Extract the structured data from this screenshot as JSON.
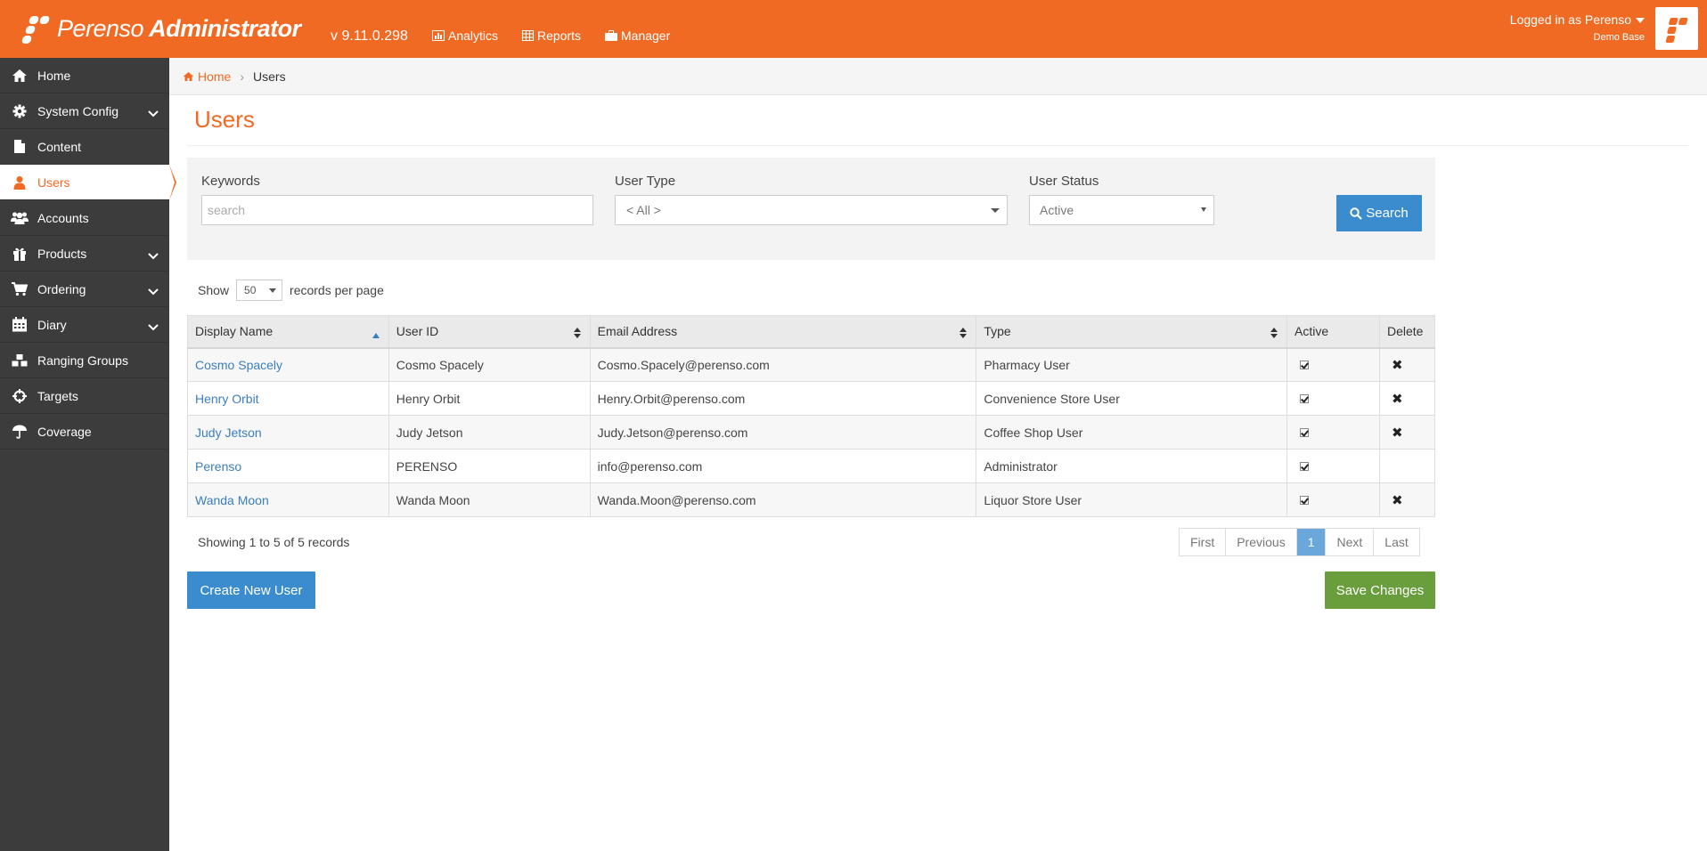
{
  "header": {
    "brand": "Perenso",
    "brand_suffix": "Administrator",
    "version": "v 9.11.0.298",
    "nav": [
      {
        "label": "Analytics",
        "icon": "bar-chart-icon"
      },
      {
        "label": "Reports",
        "icon": "table-icon"
      },
      {
        "label": "Manager",
        "icon": "briefcase-icon"
      }
    ],
    "account_label": "Logged in as Perenso",
    "account_base": "Demo Base"
  },
  "sidebar": {
    "items": [
      {
        "label": "Home",
        "icon": "home-icon",
        "expandable": false
      },
      {
        "label": "System Config",
        "icon": "gear-icon",
        "expandable": true
      },
      {
        "label": "Content",
        "icon": "file-icon",
        "expandable": false
      },
      {
        "label": "Users",
        "icon": "user-icon",
        "expandable": false,
        "active": true
      },
      {
        "label": "Accounts",
        "icon": "users-group-icon",
        "expandable": false
      },
      {
        "label": "Products",
        "icon": "gift-icon",
        "expandable": true
      },
      {
        "label": "Ordering",
        "icon": "cart-icon",
        "expandable": true
      },
      {
        "label": "Diary",
        "icon": "calendar-icon",
        "expandable": true
      },
      {
        "label": "Ranging Groups",
        "icon": "cubes-icon",
        "expandable": false
      },
      {
        "label": "Targets",
        "icon": "crosshairs-icon",
        "expandable": false
      },
      {
        "label": "Coverage",
        "icon": "umbrella-icon",
        "expandable": false
      }
    ]
  },
  "breadcrumb": {
    "home": "Home",
    "current": "Users"
  },
  "page": {
    "title": "Users"
  },
  "filters": {
    "keywords_label": "Keywords",
    "keywords_placeholder": "search",
    "user_type_label": "User Type",
    "user_type_value": "< All >",
    "user_status_label": "User Status",
    "user_status_value": "Active",
    "search_button": "Search"
  },
  "paging": {
    "show_label": "Show",
    "per_page_value": "50",
    "per_page_suffix": "records per page",
    "showing_text": "Showing 1 to 5 of 5 records",
    "buttons": [
      "First",
      "Previous",
      "1",
      "Next",
      "Last"
    ],
    "current_page": "1"
  },
  "table": {
    "headers": [
      "Display Name",
      "User ID",
      "Email Address",
      "Type",
      "Active",
      "Delete"
    ],
    "rows": [
      {
        "display_name": "Cosmo Spacely",
        "user_id": "Cosmo Spacely",
        "email": "Cosmo.Spacely@perenso.com",
        "type": "Pharmacy User",
        "active": true,
        "deletable": true
      },
      {
        "display_name": "Henry Orbit",
        "user_id": "Henry Orbit",
        "email": "Henry.Orbit@perenso.com",
        "type": "Convenience Store User",
        "active": true,
        "deletable": true
      },
      {
        "display_name": "Judy Jetson",
        "user_id": "Judy Jetson",
        "email": "Judy.Jetson@perenso.com",
        "type": "Coffee Shop User",
        "active": true,
        "deletable": true
      },
      {
        "display_name": "Perenso",
        "user_id": "PERENSO",
        "email": "info@perenso.com",
        "type": "Administrator",
        "active": true,
        "deletable": false
      },
      {
        "display_name": "Wanda Moon",
        "user_id": "Wanda Moon",
        "email": "Wanda.Moon@perenso.com",
        "type": "Liquor Store User",
        "active": true,
        "deletable": true
      }
    ]
  },
  "actions": {
    "create_label": "Create New User",
    "save_label": "Save Changes"
  },
  "colors": {
    "brand": "#f06a24",
    "sidebar": "#3c3c3c",
    "primary": "#3b8ccf",
    "success": "#6a9e3c",
    "link": "#3b7ec0"
  }
}
